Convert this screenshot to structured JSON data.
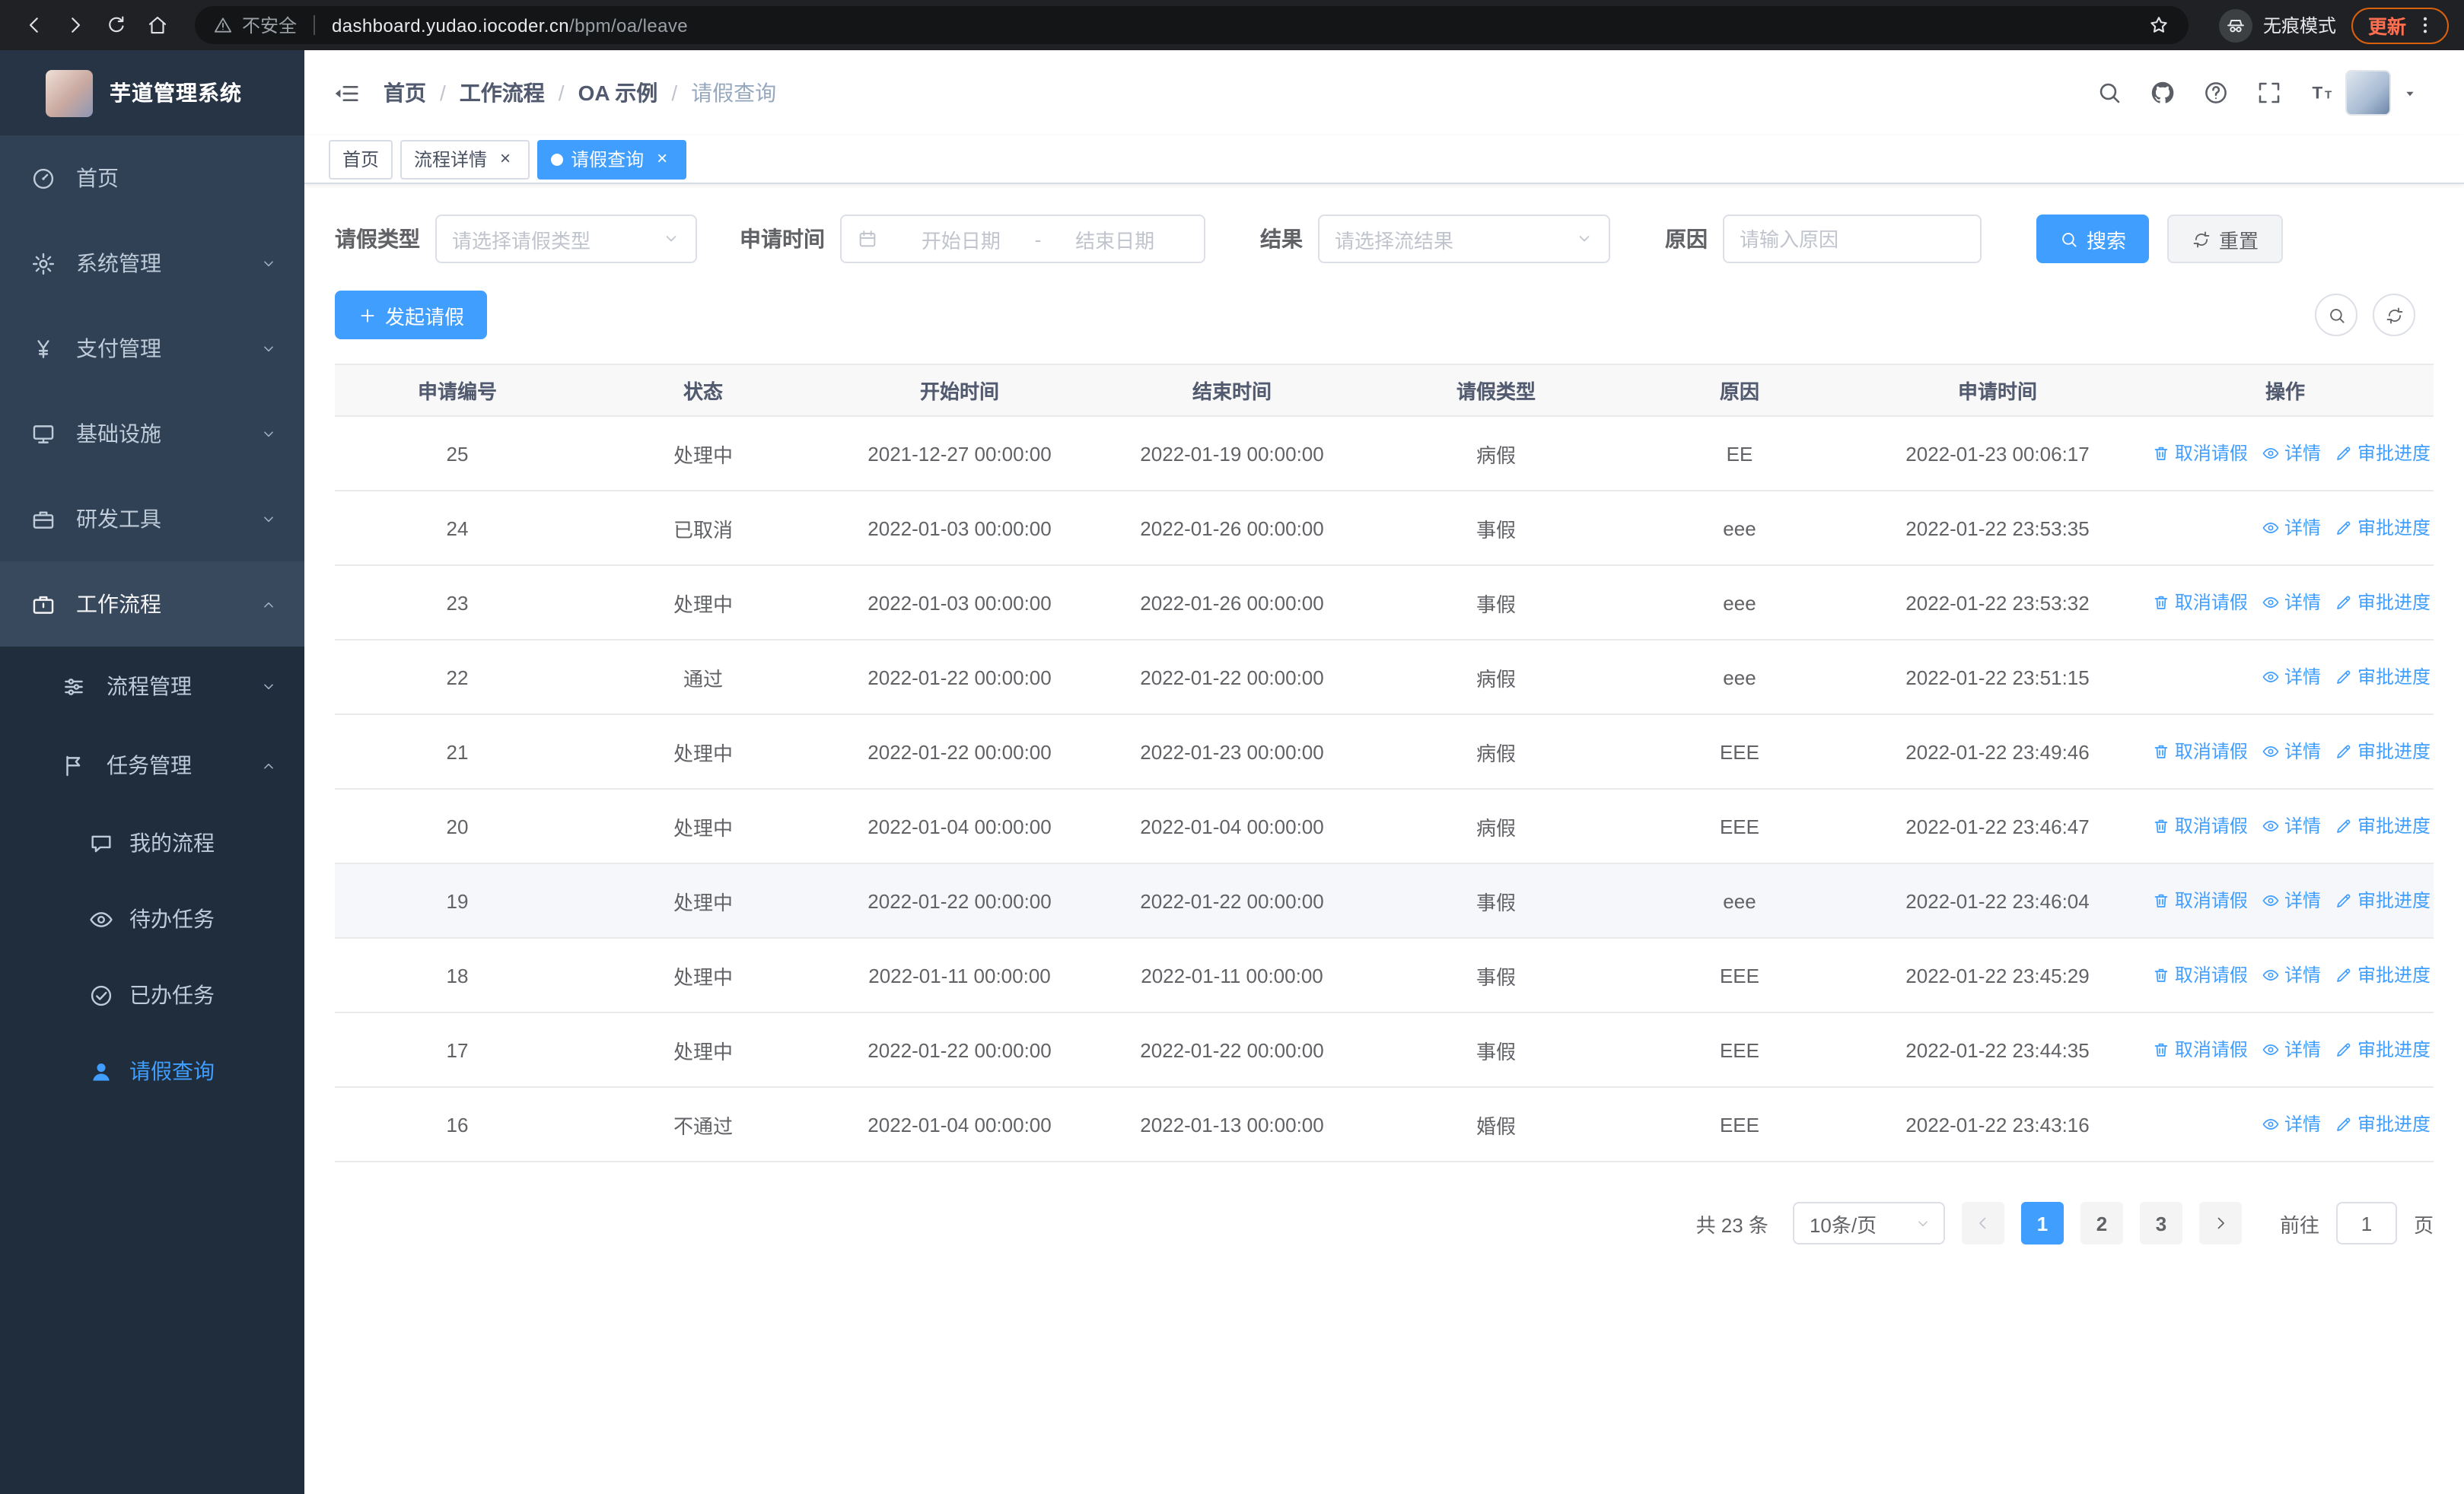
{
  "theme": {
    "primary_color": "#409eff",
    "sidebar_bg": "#304156",
    "sidebar_sub_bg": "#1f2d3d"
  },
  "browser": {
    "security_label": "不安全",
    "url_host": "dashboard.yudao.iocoder.cn",
    "url_path": "/bpm/oa/leave",
    "incognito_label": "无痕模式",
    "update_label": "更新"
  },
  "sidebar": {
    "logo_title": "芋道管理系统",
    "menu": [
      {
        "key": "home",
        "label": "首页",
        "icon": "dashboard-icon",
        "level": 1
      },
      {
        "key": "system",
        "label": "系统管理",
        "icon": "gear-icon",
        "level": 1,
        "arrow": "down"
      },
      {
        "key": "payment",
        "label": "支付管理",
        "icon": "yen-icon",
        "level": 1,
        "arrow": "down"
      },
      {
        "key": "infrastructure",
        "label": "基础设施",
        "icon": "monitor-icon",
        "level": 1,
        "arrow": "down"
      },
      {
        "key": "dev-tools",
        "label": "研发工具",
        "icon": "toolbox-icon",
        "level": 1,
        "arrow": "down"
      },
      {
        "key": "workflow",
        "label": "工作流程",
        "icon": "briefcase-icon",
        "level": 1,
        "arrow": "up",
        "expanded": true
      },
      {
        "key": "process-mgmt",
        "label": "流程管理",
        "icon": "list-icon",
        "level": 2,
        "arrow": "down"
      },
      {
        "key": "task-mgmt",
        "label": "任务管理",
        "icon": "flag-icon",
        "level": 2,
        "arrow": "up",
        "expanded": true
      },
      {
        "key": "my-process",
        "label": "我的流程",
        "icon": "chat-icon",
        "level": 3
      },
      {
        "key": "todo-task",
        "label": "待办任务",
        "icon": "eye-icon",
        "level": 3
      },
      {
        "key": "done-task",
        "label": "已办任务",
        "icon": "check-icon",
        "level": 3
      },
      {
        "key": "leave-query",
        "label": "请假查询",
        "icon": "user-icon",
        "level": 3,
        "active": true
      }
    ]
  },
  "header": {
    "breadcrumb": [
      "首页",
      "工作流程",
      "OA 示例",
      "请假查询"
    ],
    "actions": [
      {
        "name": "search",
        "icon": "search-icon"
      },
      {
        "name": "github",
        "icon": "github-icon"
      },
      {
        "name": "help",
        "icon": "question-icon"
      },
      {
        "name": "fullscreen",
        "icon": "fullscreen-icon"
      },
      {
        "name": "font-size",
        "icon": "font-size-icon"
      }
    ]
  },
  "tabs": [
    {
      "key": "home",
      "label": "首页",
      "active": false,
      "closable": false
    },
    {
      "key": "process-detail",
      "label": "流程详情",
      "active": false,
      "closable": true
    },
    {
      "key": "leave-query",
      "label": "请假查询",
      "active": true,
      "closable": true
    }
  ],
  "filters": {
    "leave_type": {
      "label": "请假类型",
      "placeholder": "请选择请假类型"
    },
    "apply_time": {
      "label": "申请时间",
      "start_placeholder": "开始日期",
      "separator": "-",
      "end_placeholder": "结束日期"
    },
    "result": {
      "label": "结果",
      "placeholder": "请选择流结果"
    },
    "reason": {
      "label": "原因",
      "placeholder": "请输入原因"
    },
    "search_button": "搜索",
    "reset_button": "重置"
  },
  "toolbar": {
    "create_button": "发起请假"
  },
  "table": {
    "columns": [
      "申请编号",
      "状态",
      "开始时间",
      "结束时间",
      "请假类型",
      "原因",
      "申请时间",
      "操作"
    ],
    "action_labels": {
      "cancel": "取消请假",
      "detail": "详情",
      "progress": "审批进度"
    },
    "action_icons": {
      "cancel": "delete-icon",
      "detail": "eye-icon",
      "progress": "edit-icon"
    },
    "rows": [
      {
        "id": "25",
        "status": "处理中",
        "start_time": "2021-12-27 00:00:00",
        "end_time": "2022-01-19 00:00:00",
        "leave_type": "病假",
        "reason": "EE",
        "apply_time": "2022-01-23 00:06:17",
        "actions": [
          "cancel",
          "detail",
          "progress"
        ]
      },
      {
        "id": "24",
        "status": "已取消",
        "start_time": "2022-01-03 00:00:00",
        "end_time": "2022-01-26 00:00:00",
        "leave_type": "事假",
        "reason": "eee",
        "apply_time": "2022-01-22 23:53:35",
        "actions": [
          "detail",
          "progress"
        ]
      },
      {
        "id": "23",
        "status": "处理中",
        "start_time": "2022-01-03 00:00:00",
        "end_time": "2022-01-26 00:00:00",
        "leave_type": "事假",
        "reason": "eee",
        "apply_time": "2022-01-22 23:53:32",
        "actions": [
          "cancel",
          "detail",
          "progress"
        ]
      },
      {
        "id": "22",
        "status": "通过",
        "start_time": "2022-01-22 00:00:00",
        "end_time": "2022-01-22 00:00:00",
        "leave_type": "病假",
        "reason": "eee",
        "apply_time": "2022-01-22 23:51:15",
        "actions": [
          "detail",
          "progress"
        ]
      },
      {
        "id": "21",
        "status": "处理中",
        "start_time": "2022-01-22 00:00:00",
        "end_time": "2022-01-23 00:00:00",
        "leave_type": "病假",
        "reason": "EEE",
        "apply_time": "2022-01-22 23:49:46",
        "actions": [
          "cancel",
          "detail",
          "progress"
        ]
      },
      {
        "id": "20",
        "status": "处理中",
        "start_time": "2022-01-04 00:00:00",
        "end_time": "2022-01-04 00:00:00",
        "leave_type": "病假",
        "reason": "EEE",
        "apply_time": "2022-01-22 23:46:47",
        "actions": [
          "cancel",
          "detail",
          "progress"
        ]
      },
      {
        "id": "19",
        "status": "处理中",
        "start_time": "2022-01-22 00:00:00",
        "end_time": "2022-01-22 00:00:00",
        "leave_type": "事假",
        "reason": "eee",
        "apply_time": "2022-01-22 23:46:04",
        "actions": [
          "cancel",
          "detail",
          "progress"
        ],
        "highlighted": true
      },
      {
        "id": "18",
        "status": "处理中",
        "start_time": "2022-01-11 00:00:00",
        "end_time": "2022-01-11 00:00:00",
        "leave_type": "事假",
        "reason": "EEE",
        "apply_time": "2022-01-22 23:45:29",
        "actions": [
          "cancel",
          "detail",
          "progress"
        ]
      },
      {
        "id": "17",
        "status": "处理中",
        "start_time": "2022-01-22 00:00:00",
        "end_time": "2022-01-22 00:00:00",
        "leave_type": "事假",
        "reason": "EEE",
        "apply_time": "2022-01-22 23:44:35",
        "actions": [
          "cancel",
          "detail",
          "progress"
        ]
      },
      {
        "id": "16",
        "status": "不通过",
        "start_time": "2022-01-04 00:00:00",
        "end_time": "2022-01-13 00:00:00",
        "leave_type": "婚假",
        "reason": "EEE",
        "apply_time": "2022-01-22 23:43:16",
        "actions": [
          "detail",
          "progress"
        ]
      }
    ]
  },
  "pagination": {
    "total_label": "共 23 条",
    "page_size_label": "10条/页",
    "pages": [
      "1",
      "2",
      "3"
    ],
    "active_page": "1",
    "goto_label": "前往",
    "goto_value": "1",
    "goto_suffix": "页"
  }
}
